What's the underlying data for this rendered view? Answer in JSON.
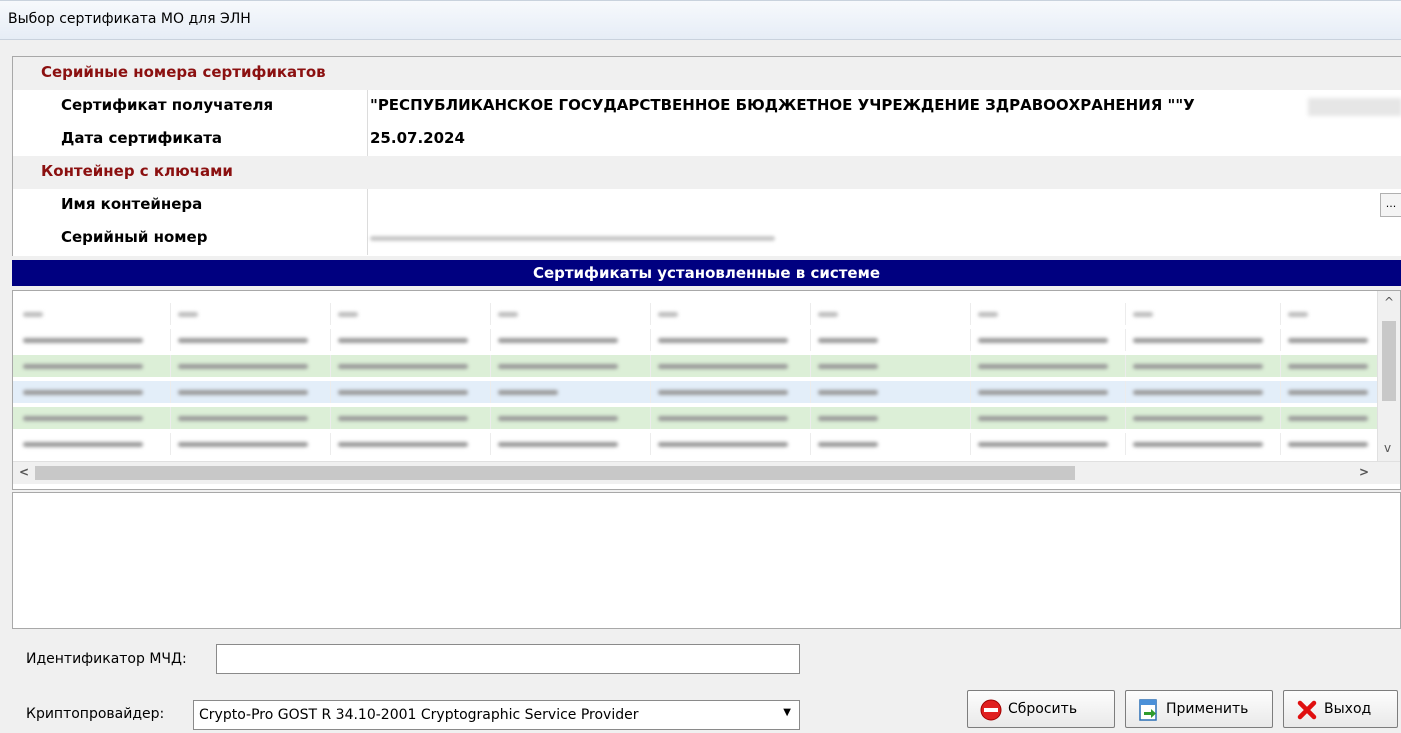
{
  "window": {
    "title": "Выбор сертификата МО для ЭЛН"
  },
  "properties": {
    "section1": "Серийные номера сертификатов",
    "recipient_label": "Сертификат получателя",
    "recipient_value": "\"РЕСПУБЛИКАНСКОЕ ГОСУДАРСТВЕННОЕ БЮДЖЕТНОЕ УЧРЕЖДЕНИЕ ЗДРАВООХРАНЕНИЯ \"\"У",
    "date_label": "Дата сертификата",
    "date_value": "25.07.2024",
    "section2": "Контейнер с ключами",
    "container_label": "Имя контейнера",
    "container_value": "",
    "container_button": "...",
    "serial_label": "Серийный номер"
  },
  "grid": {
    "banner": "Сертификаты установленные в системе",
    "scroll_up": "^",
    "scroll_down": "v",
    "scroll_left": "<",
    "scroll_right": ">"
  },
  "form": {
    "mchd_label": "Идентификатор МЧД:",
    "mchd_value": "",
    "provider_label": "Криптопровайдер:",
    "provider_value": "Crypto-Pro GOST R 34.10-2001 Cryptographic Service Provider"
  },
  "buttons": {
    "reset": "Сбросить",
    "apply": "Применить",
    "exit": "Выход"
  },
  "colors": {
    "banner": "#000080",
    "section_header": "#8b1010",
    "row_green": "#dcefd7",
    "row_blue": "#e3eef9"
  }
}
